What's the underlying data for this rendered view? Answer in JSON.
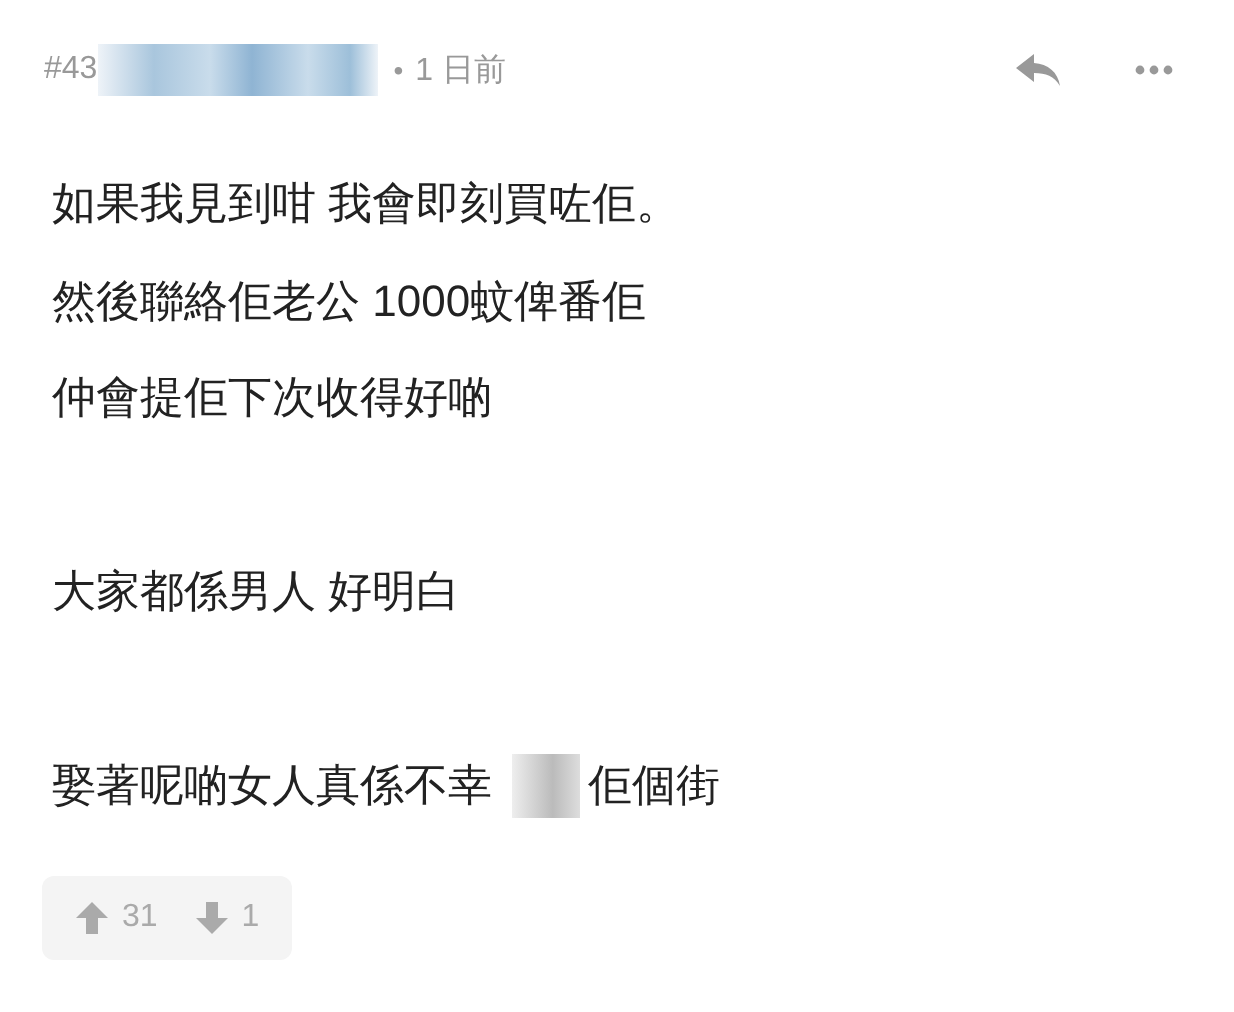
{
  "post": {
    "floor": "#43",
    "author_redacted": true,
    "separator": "•",
    "time": "1 日前"
  },
  "paragraphs": [
    {
      "lines": [
        [
          {
            "kind": "text",
            "text": "如果我見到咁 我會即刻買咗佢。"
          }
        ],
        [
          {
            "kind": "text",
            "text": "然後聯絡佢老公 1000蚊俾番佢"
          }
        ],
        [
          {
            "kind": "text",
            "text": "仲會提佢下次收得好啲"
          }
        ]
      ]
    },
    {
      "lines": [
        [
          {
            "kind": "text",
            "text": "大家都係男人 好明白"
          }
        ]
      ]
    },
    {
      "lines": [
        [
          {
            "kind": "text",
            "text": "娶著呢啲女人真係不幸"
          },
          {
            "kind": "redacted"
          },
          {
            "kind": "text",
            "text": "佢個街"
          }
        ]
      ]
    }
  ],
  "votes": {
    "up": "31",
    "down": "1"
  }
}
